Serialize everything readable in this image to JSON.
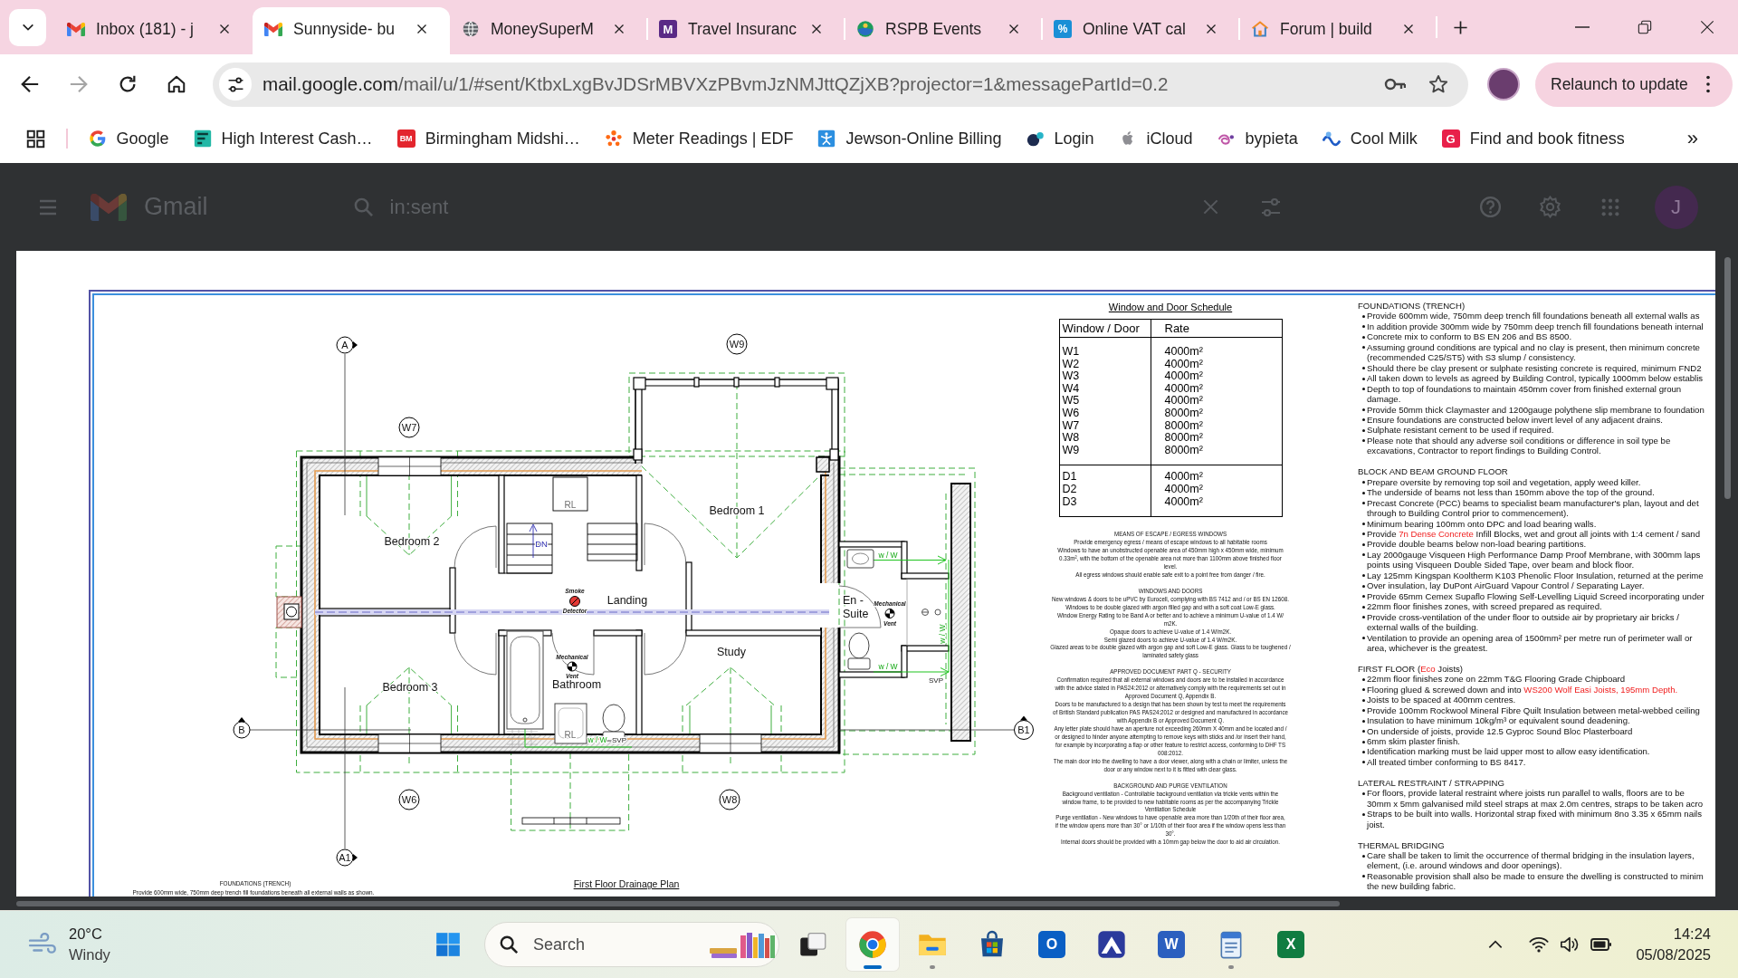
{
  "browser": {
    "tabs": [
      {
        "title": "Inbox (181) - j",
        "selected": false
      },
      {
        "title": "Sunnyside- bu",
        "selected": true
      },
      {
        "title": "MoneySuperM",
        "selected": false
      },
      {
        "title": "Travel Insuranc",
        "selected": false,
        "badge": "M"
      },
      {
        "title": "RSPB Events",
        "selected": false
      },
      {
        "title": "Online VAT cal",
        "selected": false,
        "badge": "%"
      },
      {
        "title": "Forum | build",
        "selected": false
      }
    ],
    "back_button": {
      "disabled": false
    },
    "forward_button": {
      "disabled": true
    },
    "address": {
      "host": "mail.google.com",
      "path": "/mail/u/1/#sent/KtbxLxgBvJDSrMBVXzPBvmJzNMJttQZjXB?projector=1&messagePartId=0.2"
    },
    "relaunch_button": "Relaunch to update",
    "bookmarks": [
      {
        "label": "Google"
      },
      {
        "label": "High Interest Cash…"
      },
      {
        "label": "Birmingham Midshi…",
        "badge": "BM"
      },
      {
        "label": "Meter Readings | EDF"
      },
      {
        "label": "Jewson-Online Billing"
      },
      {
        "label": "Login"
      },
      {
        "label": "iCloud"
      },
      {
        "label": "bypieta"
      },
      {
        "label": "Cool Milk"
      },
      {
        "label": "Find and book fitness",
        "badge": "G"
      }
    ],
    "bookmarks_overflow": "»"
  },
  "gmail": {
    "logo": "Gmail",
    "search": {
      "value": "in:sent"
    },
    "avatar": "J"
  },
  "document": {
    "floor_plan": {
      "grid_markers": [
        "A",
        "B",
        "B1",
        "A1"
      ],
      "window_tags": [
        "W9",
        "W7",
        "W6",
        "W8"
      ],
      "rooms": [
        "Bedroom 1",
        "Bedroom 2",
        "Landing",
        "En -\nSuite",
        "Study",
        "Bathroom",
        "Bedroom 3"
      ],
      "stair_label": "DN",
      "rl_labels": [
        "RL",
        "RL"
      ],
      "detector_labels": [
        "Smoke",
        "Detector"
      ],
      "vent_labels": [
        "Mechanical",
        "Vent",
        "Mechanical",
        "Vent"
      ],
      "pipe_labels": [
        "w / W",
        "w / W",
        "w / W",
        "w / W"
      ],
      "svp_labels": [
        "SVP",
        "SVP"
      ],
      "title": "First Floor Drainage Plan",
      "footnote": {
        "heading": "FOUNDATIONS (TRENCH)",
        "text": "Provide 600mm wide, 750mm deep trench fill foundations beneath all external walls as shown."
      }
    },
    "schedule": {
      "title": "Window and Door Schedule",
      "columns": [
        "Window / Door",
        "Rate"
      ],
      "groups": [
        {
          "rows": [
            {
              "item": "W1",
              "rate": "4000m²"
            },
            {
              "item": "W2",
              "rate": "4000m²"
            },
            {
              "item": "W3",
              "rate": "4000m²"
            },
            {
              "item": "W4",
              "rate": "4000m²"
            },
            {
              "item": "W5",
              "rate": "4000m²"
            },
            {
              "item": "W6",
              "rate": "8000m²"
            },
            {
              "item": "W7",
              "rate": "8000m²"
            },
            {
              "item": "W8",
              "rate": "8000m²"
            },
            {
              "item": "W9",
              "rate": "8000m²"
            }
          ]
        },
        {
          "rows": [
            {
              "item": "D1",
              "rate": "4000m²"
            },
            {
              "item": "D2",
              "rate": "4000m²"
            },
            {
              "item": "D3",
              "rate": "4000m²"
            }
          ]
        }
      ]
    },
    "notes": {
      "sections": [
        {
          "heading": "MEANS OF ESCAPE / EGRESS WINDOWS",
          "paragraphs": [
            "Provide emergency egress / means of escape windows to all habitable rooms",
            "Windows to have an unobstructed openable area of 450mm high x 450mm wide, minimum\n0.33m², with the bottom of the openable area not more than 1100mm above finished floor\nlevel.",
            "All egress windows should enable safe exit to a point free from danger / fire."
          ]
        },
        {
          "heading": "WINDOWS AND DOORS",
          "paragraphs": [
            "New windows & doors to be uPVC by Eurocell, complying with BS 7412 and / or BS EN 12608.",
            "Windows to be double glazed with argon filled gap and with a soft coat Low-E glass.",
            "Window Energy Rating to be Band A or better and to achieve a minimum U-value of 1.4 W/\nm2K.",
            "Opaque doors to achieve U-value of 1.4 W/m2K.",
            "Semi glazed doors to achieve U-value of 1.4 W/m2K.",
            "Glazed areas to be double glazed with argon gap and soft Low-E glass. Glass to be toughened /\nlaminated safety glass"
          ]
        },
        {
          "heading": "APPROVED DOCUMENT PART Q - SECURITY",
          "paragraphs": [
            "Confirmation required that all external windows and doors are to be installed in accordance\nwith the advice stated in PAS24:2012 or alternatively comply with the requirements set out in\nApproved Document Q, Appendix B.",
            "Doors to be manufactured to a design that has been shown by test to meet the requirements\nof British Standard publication PAS PAS24:2012 or designed and manufactured in accordance\nwith Appendix B or Approved Document Q.",
            "Any letter plate should have an aperture not exceeding 260mm X 40mm and be located and /\nor designed to hinder anyone attempting to remove keys with sticks and /or insert their hand,\nfor example by incorporating a flap or other feature to restrict access, conforming to DHF TS\n008:2012.",
            "The main door into the dwelling to have a door viewer, along with a chain or limiter, unless the\ndoor or any window next to it is fitted with clear glass."
          ]
        },
        {
          "heading": "BACKGROUND AND PURGE VENTILATION",
          "paragraphs": [
            "Background ventilation - Controllable background ventilation via trickle vents within the\nwindow frame, to be provided to new habitable rooms as per the accompanying Trickle\nVentilation Schedule",
            "Purge ventilation - New windows to have openable area more than 1/20th of their floor area,\nif the window opens more than 30° or 1/10th of their floor area if the window opens less than\n30°.",
            "Internal doors should be provided with a 10mm gap below the door to aid air circulation."
          ]
        }
      ]
    },
    "specification": {
      "sections": [
        {
          "heading": "FOUNDATIONS (TRENCH)",
          "items": [
            "Provide 600mm wide, 750mm deep trench fill foundations beneath all external walls as",
            "In addition provide 300mm wide by 750mm deep trench fill foundations beneath internal",
            "Concrete mix to conform to BS EN 206 and BS 8500.",
            "Assuming ground conditions are typical and no clay is present, then minimum concrete\n(recommended C25/ST5) with S3 slump / consistency.",
            "Should there be clay present or sulphate resisting concrete is required, minimum FND2",
            "All taken down to levels as agreed by Building Control, typically 1000mm below establis",
            "Depth to top of foundations to maintain 450mm cover from finished external groun\ndamage.",
            "Provide 50mm thick Claymaster and 1200gauge polythene slip membrane to foundation",
            "Ensure foundations are constructed below invert level of any adjacent drains.",
            "Sulphate resistant cement to be used if required.",
            "Please note that should any adverse soil conditions or difference in soil type be\nexcavations, Contractor to report findings to Building Control."
          ]
        },
        {
          "heading": "BLOCK AND BEAM GROUND FLOOR",
          "items": [
            "Prepare oversite by removing top soil and vegetation, apply weed killer.",
            "The underside of beams not less than 150mm above the top of the ground.",
            "Precast Concrete (PCC) beams to specialist beam manufacturer's plan, layout and det\nthrough to Building Control prior to commencement).",
            "Minimum bearing 100mm onto DPC and load bearing walls.",
            {
              "segments": [
                {
                  "text": "Provide ",
                  "highlight": false
                },
                {
                  "text": "7n Dense Concrete",
                  "highlight": true
                },
                {
                  "text": " Infill Blocks, wet and grout all joints with 1:4 cement / sand",
                  "highlight": false
                }
              ]
            },
            "Provide double beams below non-load bearing partitions.",
            "Lay 2000gauge Visqueen High Performance Damp Proof Membrane, with 300mm laps\npoints using Visqueen Double Sided Tape, over beam and block floor.",
            "Lay 125mm Kingspan Kooltherm K103 Phenolic Floor Insulation, returned at the perime",
            "Over insulation, lay DuPont AirGuard Vapour Control / Separating Layer.",
            "Provide 65mm Cemex Supaflo Flowing Self-Levelling Liquid Screed incorporating under",
            "22mm floor finishes zones, with screed prepared as required.",
            "Provide cross-ventilation of the under floor to outside air by proprietary air bricks /\nexternal walls of the building.",
            "Ventilation to provide an opening area of 1500mm² per metre run of perimeter wall or\narea, whichever is the greatest."
          ]
        },
        {
          "heading": {
            "segments": [
              {
                "text": "FIRST FLOOR (",
                "highlight": false
              },
              {
                "text": "Eco",
                "highlight": true
              },
              {
                "text": " Joists)",
                "highlight": false
              }
            ]
          },
          "items": [
            "22mm floor finishes zone on 22mm T&G Flooring Grade Chipboard",
            {
              "segments": [
                {
                  "text": "Flooring glued & screwed down and into ",
                  "highlight": false
                },
                {
                  "text": "WS200 Wolf Easi Joists, 195mm Depth.",
                  "highlight": true
                }
              ]
            },
            "Joists to be spaced at 400mm centres.",
            "Provide 100mm Rockwool Mineral Fibre Quilt Insulation between metal-webbed ceiling",
            "Insulation to have minimum 10kg/m³ or equivalent sound deadening.",
            "On underside of joists, provide 12.5 Gyproc Sound Bloc Plasterboard",
            "6mm skim plaster finish.",
            "Identification marking must be laid upper most to allow easy identification.",
            "All treated timber conforming to BS 8417."
          ]
        },
        {
          "heading": "LATERAL RESTRAINT / STRAPPING",
          "items": [
            "For floors, provide lateral restraint where joists run parallel to walls, floors are to be\n30mm x 5mm galvanised mild steel straps at max 2.0m centres, straps to be taken acro",
            "Straps to be built into walls. Horizontal strap fixed with minimum 8no 3.35 x 65mm nails\njoist."
          ]
        },
        {
          "heading": "THERMAL BRIDGING",
          "items": [
            "Care shall be taken to limit the occurrence of thermal bridging in the insulation layers,\nelement, (i.e. around windows and door openings).",
            "Reasonable provision shall also be made to ensure the dwelling is constructed to minim\nthe new building fabric."
          ]
        }
      ]
    }
  },
  "taskbar": {
    "weather": {
      "temperature": "20°C",
      "condition": "Windy"
    },
    "search": {
      "placeholder": "Search"
    },
    "apps": [
      {
        "selected": true,
        "running": true
      },
      {
        "selected": false,
        "running": true
      },
      {
        "selected": false,
        "running": false
      },
      {
        "selected": false,
        "running": false,
        "badge": "O"
      },
      {
        "selected": false,
        "running": false
      },
      {
        "selected": false,
        "running": false,
        "badge": "W"
      },
      {
        "selected": false,
        "running": true
      },
      {
        "selected": false,
        "running": false,
        "badge": "X"
      }
    ],
    "clock": {
      "time": "14:24",
      "date": "05/08/2025"
    }
  }
}
